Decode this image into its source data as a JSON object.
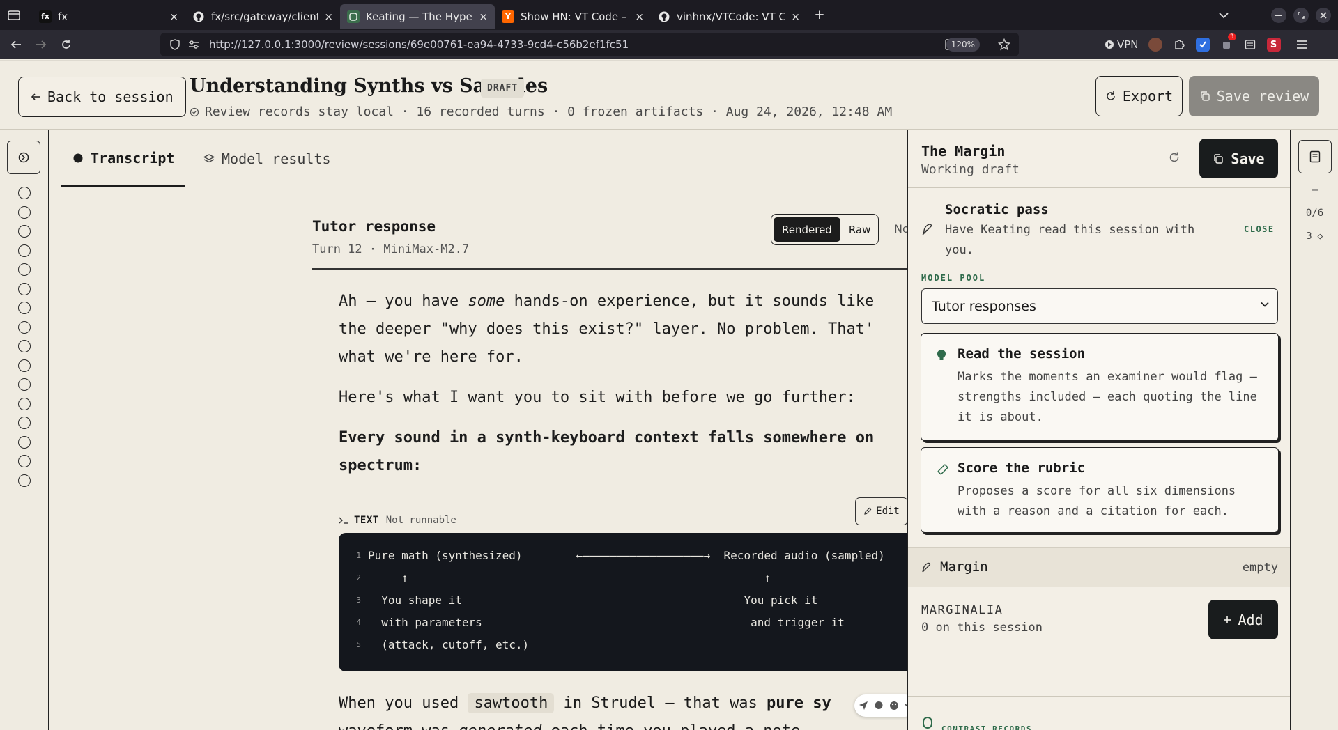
{
  "browser": {
    "tabs": [
      {
        "title": "fx",
        "favicon": "fx",
        "active": false
      },
      {
        "title": "fx/src/gateway/client.zig",
        "favicon": "github-icon",
        "active": false
      },
      {
        "title": "Keating — The Hypertext",
        "favicon": "keating-icon",
        "active": true
      },
      {
        "title": "Show HN: VT Code – Rust",
        "favicon": "Y",
        "active": false
      },
      {
        "title": "vinhnx/VTCode: VT Code",
        "favicon": "github-icon",
        "active": false
      }
    ],
    "url": "http://127.0.0.1:3000/review/sessions/69e00761-ea94-4733-9cd4-c56b2ef1fc51",
    "zoom": "120%",
    "vpn_label": "VPN",
    "ext_badge": "3",
    "ext_s": "S",
    "new_tab": "+",
    "close": "×"
  },
  "header": {
    "back_label": "Back to session",
    "title": "Understanding Synths vs Samples",
    "badge": "DRAFT",
    "meta": "Review records stay local · 16 recorded turns · 0 frozen artifacts · Aug 24, 2026, 12:48 AM",
    "export_label": "Export",
    "save_review_label": "Save review"
  },
  "rail": {
    "turn_count": 16
  },
  "main": {
    "tabs": {
      "transcript": "Transcript",
      "model_results": "Model results"
    },
    "response": {
      "title": "Tutor response",
      "subtitle": "Turn 12 · MiniMax-M2.7",
      "toggle_rendered": "Rendered",
      "toggle_raw": "Raw",
      "notes_cut": "No"
    },
    "paragraphs": {
      "p1a": "Ah — you have ",
      "p1em": "some",
      "p1b": " hands-on experience, but it sounds like",
      "p1c": "the deeper \"why does this exist?\" layer. No problem. That'",
      "p1d": "what we're here for.",
      "p2": "Here's what I want you to sit with before we go further:",
      "p3a": "Every sound in a synth-keyboard context falls somewhere on",
      "p3b": "spectrum:"
    },
    "code": {
      "lang": "TEXT",
      "state": "Not runnable",
      "edit_label": "Edit",
      "lines": [
        "Pure math (synthesized)        ←——————————————————→  Recorded audio (sampled)",
        "     ↑                                                     ↑",
        "  You shape it                                          You pick it",
        "  with parameters                                        and trigger it",
        "  (attack, cutoff, etc.)"
      ]
    },
    "after": {
      "a": "When you used ",
      "code": "sawtooth",
      "b": " in Strudel — that was ",
      "bold": "pure sy",
      "line2a": "waveform was ",
      "line2em": "generated",
      "line2b": " each time you played a note"
    }
  },
  "margin_panel": {
    "title": "The Margin",
    "subtitle": "Working draft",
    "save_label": "Save",
    "socratic": {
      "title": "Socratic pass",
      "desc": "Have Keating read this session with you.",
      "close": "CLOSE"
    },
    "pool_label": "MODEL POOL",
    "pool_value": "Tutor responses",
    "cards": {
      "read": {
        "title": "Read the session",
        "desc": "Marks the moments an examiner would flag — strengths included — each quoting the line it is about."
      },
      "score": {
        "title": "Score the rubric",
        "desc": "Proposes a score for all six dimensions with a reason and a citation for each."
      }
    },
    "margin_section": {
      "title": "Margin",
      "state": "empty"
    },
    "marginalia": {
      "label": "MARGINALIA",
      "count": "0 on this session",
      "add_label": "Add"
    },
    "contrast_label": "CONTRAST RECORDS"
  },
  "right_rail": {
    "dash": "–",
    "progress": "0/6",
    "count": "3"
  },
  "colors": {
    "accent_green": "#2e6a4a",
    "dark": "#191c1d",
    "paper": "#f0ece2"
  }
}
